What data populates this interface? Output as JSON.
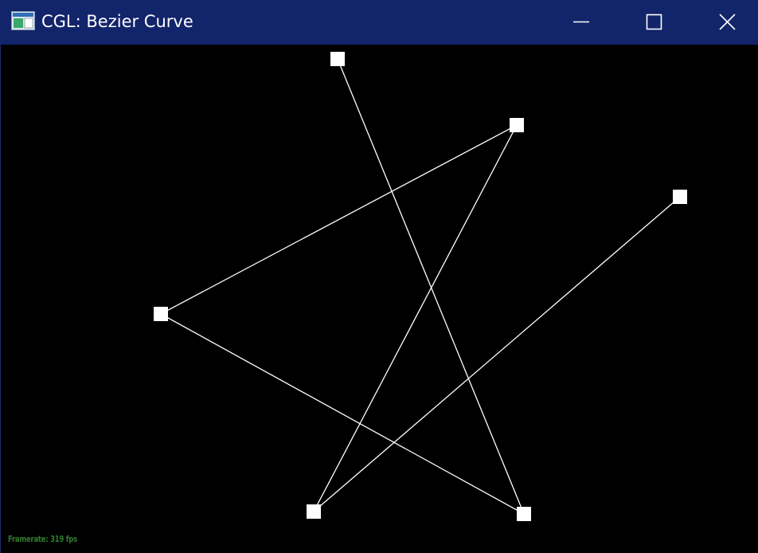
{
  "window": {
    "title": "CGL: Bezier Curve",
    "icon": "app-window-icon",
    "colors": {
      "titlebar": "#12246a",
      "canvas": "#000000",
      "curve": "#ffffff",
      "framerate_text": "#2f7d2f"
    }
  },
  "controls": {
    "minimize_icon": "minimize-icon",
    "maximize_icon": "maximize-icon",
    "close_icon": "close-icon"
  },
  "status": {
    "framerate": "Framerate: 319 fps"
  }
}
